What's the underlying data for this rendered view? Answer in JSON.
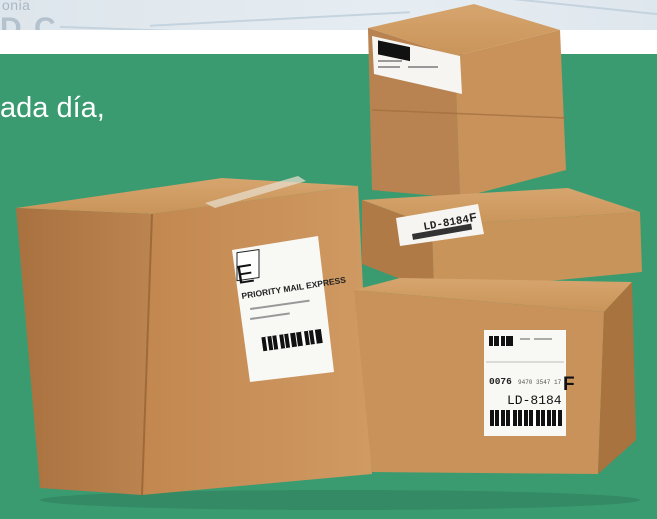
{
  "map": {
    "place_fragment": "onia",
    "big_fragment": "D C"
  },
  "headline": "ada día,",
  "label_large": {
    "service_letter": "E",
    "service_name": "PRIORITY MAIL EXPRESS"
  },
  "label_front": {
    "tracking_prefix": "0076",
    "tracking_digits": "9470 3547 17",
    "service_letter": "F",
    "route_code": "LD-8184"
  },
  "label_middle": {
    "route_code": "LD-8184",
    "service_letter": "F"
  },
  "colors": {
    "panel_green": "#3a9b70",
    "cardboard": "#c9955b",
    "headline_text": "#ffffff"
  }
}
